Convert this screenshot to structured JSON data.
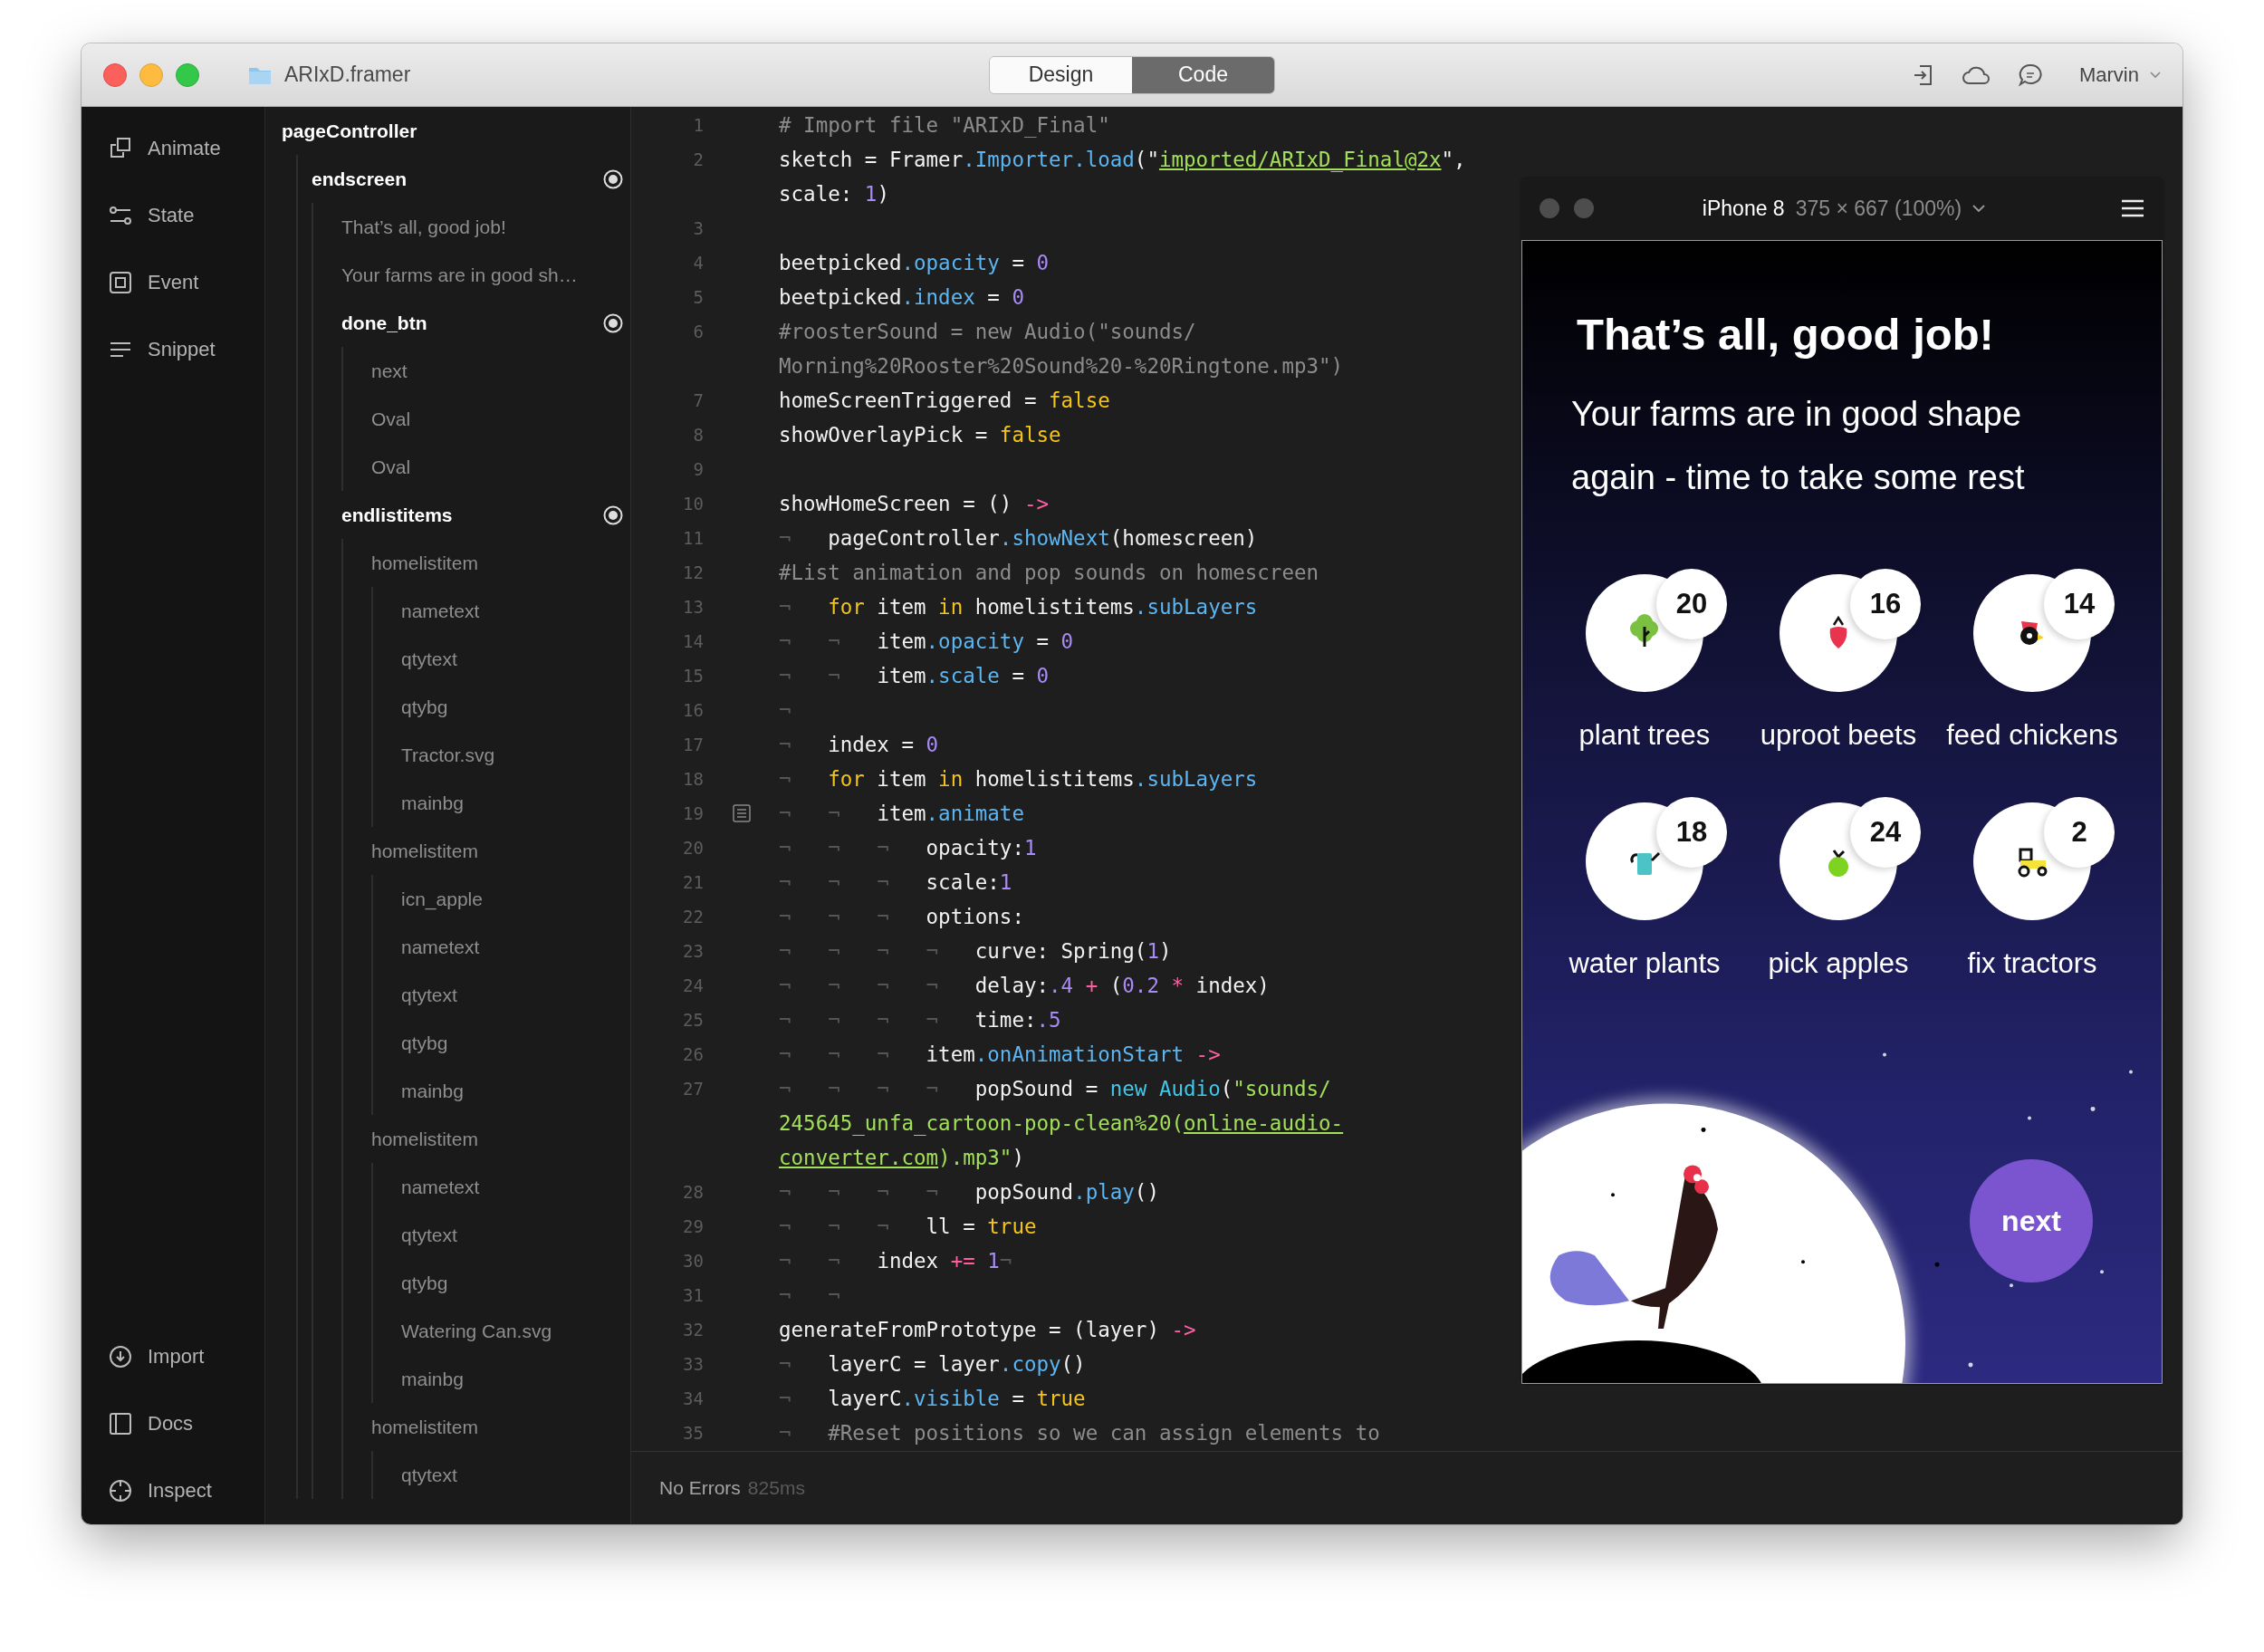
{
  "window": {
    "title": "ARIxD.framer",
    "user": "Marvin"
  },
  "mode_tabs": [
    {
      "label": "Design",
      "selected": false
    },
    {
      "label": "Code",
      "selected": true
    }
  ],
  "sidebar": {
    "top": [
      {
        "label": "Animate"
      },
      {
        "label": "State"
      },
      {
        "label": "Event"
      },
      {
        "label": "Snippet"
      }
    ],
    "bottom": [
      {
        "label": "Import"
      },
      {
        "label": "Docs"
      },
      {
        "label": "Inspect"
      }
    ]
  },
  "layers": [
    {
      "label": "pageController",
      "kind": "root",
      "children": [
        {
          "label": "endscreen",
          "kind": "group",
          "children": [
            {
              "label": "That’s all, good job!",
              "kind": "layer"
            },
            {
              "label": "Your farms are in good sh…",
              "kind": "layer"
            },
            {
              "label": "done_btn",
              "kind": "group",
              "children": [
                {
                  "label": "next",
                  "kind": "layer"
                },
                {
                  "label": "Oval",
                  "kind": "layer"
                },
                {
                  "label": "Oval",
                  "kind": "layer"
                }
              ]
            },
            {
              "label": "endlistitems",
              "kind": "group",
              "children": [
                {
                  "label": "homelistitem",
                  "kind": "layer",
                  "children": [
                    {
                      "label": "nametext",
                      "kind": "layer"
                    },
                    {
                      "label": "qtytext",
                      "kind": "layer"
                    },
                    {
                      "label": "qtybg",
                      "kind": "layer"
                    },
                    {
                      "label": "Tractor.svg",
                      "kind": "layer"
                    },
                    {
                      "label": "mainbg",
                      "kind": "layer"
                    }
                  ]
                },
                {
                  "label": "homelistitem",
                  "kind": "layer",
                  "children": [
                    {
                      "label": "icn_apple",
                      "kind": "layer"
                    },
                    {
                      "label": "nametext",
                      "kind": "layer"
                    },
                    {
                      "label": "qtytext",
                      "kind": "layer"
                    },
                    {
                      "label": "qtybg",
                      "kind": "layer"
                    },
                    {
                      "label": "mainbg",
                      "kind": "layer"
                    }
                  ]
                },
                {
                  "label": "homelistitem",
                  "kind": "layer",
                  "children": [
                    {
                      "label": "nametext",
                      "kind": "layer"
                    },
                    {
                      "label": "qtytext",
                      "kind": "layer"
                    },
                    {
                      "label": "qtybg",
                      "kind": "layer"
                    },
                    {
                      "label": "Watering Can.svg",
                      "kind": "layer"
                    },
                    {
                      "label": "mainbg",
                      "kind": "layer"
                    }
                  ]
                },
                {
                  "label": "homelistitem",
                  "kind": "layer",
                  "children": [
                    {
                      "label": "qtytext",
                      "kind": "layer"
                    }
                  ]
                }
              ]
            }
          ]
        }
      ]
    }
  ],
  "code": {
    "lines": [
      {
        "number": "1",
        "fold": false,
        "tokens": [
          {
            "kind": "comment",
            "text": "# Import file \"ARIxD_Final\""
          }
        ]
      },
      {
        "number": "2",
        "fold": false,
        "tokens": [
          {
            "kind": "plain",
            "text": "sketch = Framer"
          },
          {
            "kind": "property",
            "text": ".Importer"
          },
          {
            "kind": "property",
            "text": ".load"
          },
          {
            "kind": "plain",
            "text": "(\""
          },
          {
            "kind": "link",
            "text": "imported/ARIxD_Final@2x"
          },
          {
            "kind": "plain",
            "text": "\","
          }
        ]
      },
      {
        "tokens": [
          {
            "kind": "plain",
            "text": "scale: "
          },
          {
            "kind": "number",
            "text": "1"
          },
          {
            "kind": "plain",
            "text": ")"
          }
        ]
      },
      {
        "number": "3",
        "fold": false
      },
      {
        "number": "4",
        "fold": false,
        "tokens": [
          {
            "kind": "plain",
            "text": "beetpicked"
          },
          {
            "kind": "property",
            "text": ".opacity"
          },
          {
            "kind": "plain",
            "text": " = "
          },
          {
            "kind": "number",
            "text": "0"
          }
        ]
      },
      {
        "number": "5",
        "fold": false,
        "tokens": [
          {
            "kind": "plain",
            "text": "beetpicked"
          },
          {
            "kind": "property",
            "text": ".index"
          },
          {
            "kind": "plain",
            "text": " = "
          },
          {
            "kind": "number",
            "text": "0"
          }
        ]
      },
      {
        "number": "6",
        "fold": false,
        "tokens": [
          {
            "kind": "comment",
            "text": "#roosterSound = new Audio(\"sounds/"
          }
        ]
      },
      {
        "tokens": [
          {
            "kind": "comment",
            "text": "Morning%20Rooster%20Sound%20-%20Ringtone.mp3\")"
          }
        ]
      },
      {
        "number": "7",
        "fold": false,
        "tokens": [
          {
            "kind": "plain",
            "text": "homeScreenTriggered = "
          },
          {
            "kind": "keyword",
            "text": "false"
          }
        ]
      },
      {
        "number": "8",
        "fold": false,
        "tokens": [
          {
            "kind": "plain",
            "text": "showOverlayPick = "
          },
          {
            "kind": "keyword",
            "text": "false"
          }
        ]
      },
      {
        "number": "9",
        "fold": false
      },
      {
        "number": "10",
        "fold": false,
        "tokens": [
          {
            "kind": "plain",
            "text": "showHomeScreen = () "
          },
          {
            "kind": "operator",
            "text": "->"
          }
        ]
      },
      {
        "number": "11",
        "fold": false,
        "tokens": [
          {
            "kind": "indent",
            "text": "¬   "
          },
          {
            "kind": "plain",
            "text": "pageController"
          },
          {
            "kind": "property",
            "text": ".showNext"
          },
          {
            "kind": "plain",
            "text": "(homescreen)"
          }
        ]
      },
      {
        "number": "12",
        "fold": false,
        "tokens": [
          {
            "kind": "comment",
            "text": "#List animation and pop sounds on homescreen"
          }
        ]
      },
      {
        "number": "13",
        "fold": false,
        "tokens": [
          {
            "kind": "indent",
            "text": "¬   "
          },
          {
            "kind": "keyword",
            "text": "for"
          },
          {
            "kind": "plain",
            "text": " item "
          },
          {
            "kind": "keyword",
            "text": "in"
          },
          {
            "kind": "plain",
            "text": " homelistitems"
          },
          {
            "kind": "property",
            "text": ".subLayers"
          }
        ]
      },
      {
        "number": "14",
        "fold": false,
        "tokens": [
          {
            "kind": "indent",
            "text": "¬   ¬   "
          },
          {
            "kind": "plain",
            "text": "item"
          },
          {
            "kind": "property",
            "text": ".opacity"
          },
          {
            "kind": "plain",
            "text": " = "
          },
          {
            "kind": "number",
            "text": "0"
          }
        ]
      },
      {
        "number": "15",
        "fold": false,
        "tokens": [
          {
            "kind": "indent",
            "text": "¬   ¬   "
          },
          {
            "kind": "plain",
            "text": "item"
          },
          {
            "kind": "property",
            "text": ".scale"
          },
          {
            "kind": "plain",
            "text": " = "
          },
          {
            "kind": "number",
            "text": "0"
          }
        ]
      },
      {
        "number": "16",
        "fold": false,
        "tokens": [
          {
            "kind": "indent",
            "text": "¬"
          }
        ]
      },
      {
        "number": "17",
        "fold": false,
        "tokens": [
          {
            "kind": "indent",
            "text": "¬   "
          },
          {
            "kind": "plain",
            "text": "index = "
          },
          {
            "kind": "number",
            "text": "0"
          }
        ]
      },
      {
        "number": "18",
        "fold": false,
        "tokens": [
          {
            "kind": "indent",
            "text": "¬   "
          },
          {
            "kind": "keyword",
            "text": "for"
          },
          {
            "kind": "plain",
            "text": " item "
          },
          {
            "kind": "keyword",
            "text": "in"
          },
          {
            "kind": "plain",
            "text": " homelistitems"
          },
          {
            "kind": "property",
            "text": ".subLayers"
          }
        ]
      },
      {
        "number": "19",
        "fold": true,
        "tokens": [
          {
            "kind": "indent",
            "text": "¬   ¬   "
          },
          {
            "kind": "plain",
            "text": "item"
          },
          {
            "kind": "property",
            "text": ".animate"
          }
        ]
      },
      {
        "number": "20",
        "fold": false,
        "tokens": [
          {
            "kind": "indent",
            "text": "¬   ¬   ¬   "
          },
          {
            "kind": "plain",
            "text": "opacity:"
          },
          {
            "kind": "number",
            "text": "1"
          }
        ]
      },
      {
        "number": "21",
        "fold": false,
        "tokens": [
          {
            "kind": "indent",
            "text": "¬   ¬   ¬   "
          },
          {
            "kind": "plain",
            "text": "scale:"
          },
          {
            "kind": "number",
            "text": "1"
          }
        ]
      },
      {
        "number": "22",
        "fold": false,
        "tokens": [
          {
            "kind": "indent",
            "text": "¬   ¬   ¬   "
          },
          {
            "kind": "plain",
            "text": "options:"
          }
        ]
      },
      {
        "number": "23",
        "fold": false,
        "tokens": [
          {
            "kind": "indent",
            "text": "¬   ¬   ¬   ¬   "
          },
          {
            "kind": "plain",
            "text": "curve: Spring("
          },
          {
            "kind": "number",
            "text": "1"
          },
          {
            "kind": "plain",
            "text": ")"
          }
        ]
      },
      {
        "number": "24",
        "fold": false,
        "tokens": [
          {
            "kind": "indent",
            "text": "¬   ¬   ¬   ¬   "
          },
          {
            "kind": "plain",
            "text": "delay:"
          },
          {
            "kind": "number",
            "text": ".4"
          },
          {
            "kind": "operator",
            "text": " +"
          },
          {
            "kind": "plain",
            "text": " ("
          },
          {
            "kind": "number",
            "text": "0.2"
          },
          {
            "kind": "operator",
            "text": " *"
          },
          {
            "kind": "plain",
            "text": " index)"
          }
        ]
      },
      {
        "number": "25",
        "fold": false,
        "tokens": [
          {
            "kind": "indent",
            "text": "¬   ¬   ¬   ¬   "
          },
          {
            "kind": "plain",
            "text": "time:"
          },
          {
            "kind": "number",
            "text": ".5"
          }
        ]
      },
      {
        "number": "26",
        "fold": false,
        "tokens": [
          {
            "kind": "indent",
            "text": "¬   ¬   ¬   "
          },
          {
            "kind": "plain",
            "text": "item"
          },
          {
            "kind": "property",
            "text": ".onAnimationStart"
          },
          {
            "kind": "operator",
            "text": " ->"
          }
        ]
      },
      {
        "number": "27",
        "fold": false,
        "tokens": [
          {
            "kind": "indent",
            "text": "¬   ¬   ¬   ¬   "
          },
          {
            "kind": "plain",
            "text": "popSound = "
          },
          {
            "kind": "builtin",
            "text": "new Audio"
          },
          {
            "kind": "plain",
            "text": "("
          },
          {
            "kind": "string",
            "text": "\"sounds/"
          }
        ]
      },
      {
        "tokens": [
          {
            "kind": "string",
            "text": "245645_unfa_cartoon-pop-clean%20("
          },
          {
            "kind": "link",
            "text": "online-audio-"
          }
        ]
      },
      {
        "tokens": [
          {
            "kind": "link",
            "text": "converter.com"
          },
          {
            "kind": "string",
            "text": ").mp3\""
          },
          {
            "kind": "plain",
            "text": ")"
          }
        ]
      },
      {
        "number": "28",
        "fold": false,
        "tokens": [
          {
            "kind": "indent",
            "text": "¬   ¬   ¬   ¬   "
          },
          {
            "kind": "plain",
            "text": "popSound"
          },
          {
            "kind": "property",
            "text": ".play"
          },
          {
            "kind": "plain",
            "text": "()"
          }
        ]
      },
      {
        "number": "29",
        "fold": false,
        "tokens": [
          {
            "kind": "indent",
            "text": "¬   ¬   ¬   "
          },
          {
            "kind": "plain",
            "text": "ll = "
          },
          {
            "kind": "keyword",
            "text": "true"
          }
        ]
      },
      {
        "number": "30",
        "fold": false,
        "tokens": [
          {
            "kind": "indent",
            "text": "¬   ¬   "
          },
          {
            "kind": "plain",
            "text": "index "
          },
          {
            "kind": "operator",
            "text": "+= "
          },
          {
            "kind": "number",
            "text": "1"
          },
          {
            "kind": "mark",
            "text": "¬"
          }
        ]
      },
      {
        "number": "31",
        "fold": false,
        "tokens": [
          {
            "kind": "indent",
            "text": "¬   ¬"
          }
        ]
      },
      {
        "number": "32",
        "fold": false,
        "tokens": [
          {
            "kind": "plain",
            "text": "generateFromPrototype = (layer) "
          },
          {
            "kind": "operator",
            "text": "->"
          }
        ]
      },
      {
        "number": "33",
        "fold": false,
        "tokens": [
          {
            "kind": "indent",
            "text": "¬   "
          },
          {
            "kind": "plain",
            "text": "layerC = layer"
          },
          {
            "kind": "property",
            "text": ".copy"
          },
          {
            "kind": "plain",
            "text": "()"
          }
        ]
      },
      {
        "number": "34",
        "fold": false,
        "tokens": [
          {
            "kind": "indent",
            "text": "¬   "
          },
          {
            "kind": "plain",
            "text": "layerC"
          },
          {
            "kind": "property",
            "text": ".visible"
          },
          {
            "kind": "plain",
            "text": " = "
          },
          {
            "kind": "keyword",
            "text": "true"
          }
        ]
      },
      {
        "number": "35",
        "fold": false,
        "tokens": [
          {
            "kind": "indent",
            "text": "¬   "
          },
          {
            "kind": "comment",
            "text": "#Reset positions so we can assign elements to"
          }
        ]
      }
    ]
  },
  "status_bar": {
    "message": "No Errors",
    "time": "825ms"
  },
  "preview": {
    "device": "iPhone 8",
    "size": "375 × 667 (100%)",
    "title": "That’s all, good job!",
    "subtitle": "Your farms are in good shape again - time to take some rest",
    "tasks": [
      {
        "label": "plant trees",
        "count": "20"
      },
      {
        "label": "uproot beets",
        "count": "16"
      },
      {
        "label": "feed chickens",
        "count": "14"
      },
      {
        "label": "water plants",
        "count": "18"
      },
      {
        "label": "pick apples",
        "count": "24"
      },
      {
        "label": "fix tractors",
        "count": "2"
      }
    ],
    "button": "next"
  }
}
